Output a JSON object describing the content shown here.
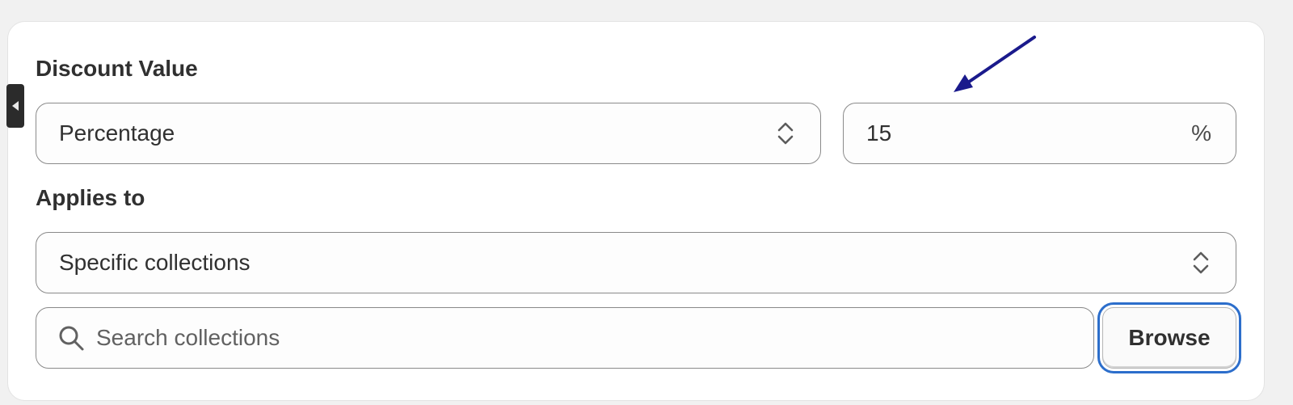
{
  "discount": {
    "label": "Discount Value",
    "type_select": {
      "value": "Percentage"
    },
    "amount_input": {
      "value": "15",
      "suffix": "%"
    }
  },
  "applies": {
    "label": "Applies to",
    "scope_select": {
      "value": "Specific collections"
    },
    "search": {
      "placeholder": "Search collections"
    },
    "browse_label": "Browse"
  },
  "colors": {
    "focus_ring": "#2c6ecb",
    "annotation_arrow": "#1a1a8c",
    "text": "#303030"
  },
  "icons": {
    "stepper": "chevron-up-down-icon",
    "search": "search-icon",
    "side_tab": "caret-left-icon",
    "annotation": "arrow-annotation-icon"
  }
}
